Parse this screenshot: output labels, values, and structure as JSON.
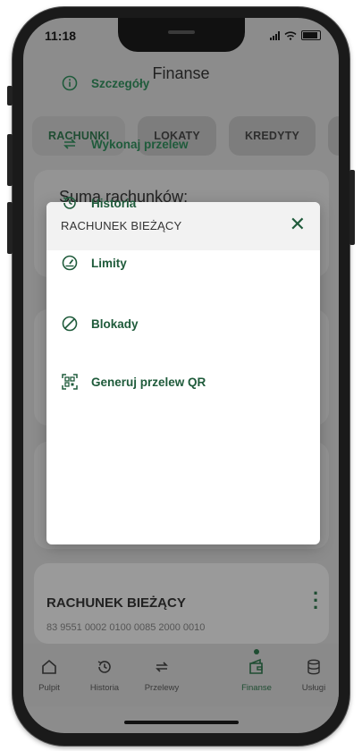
{
  "status_bar": {
    "time": "11:18"
  },
  "header": {
    "title": "Finanse"
  },
  "tabs": [
    {
      "label": "RACHUNKI"
    },
    {
      "label": "LOKATY"
    },
    {
      "label": "KREDYTY"
    },
    {
      "label": "KA"
    }
  ],
  "summary": {
    "label": "Suma rachunków:"
  },
  "modal": {
    "title": "RACHUNEK BIEŻĄCY",
    "items": [
      {
        "label": "Szczegóły",
        "icon": "info-icon"
      },
      {
        "label": "Wykonaj przelew",
        "icon": "transfer-icon"
      },
      {
        "label": "Historia",
        "icon": "history-icon"
      },
      {
        "label": "Limity",
        "icon": "gauge-icon"
      },
      {
        "label": "Blokady",
        "icon": "block-icon"
      },
      {
        "label": "Generuj przelew QR",
        "icon": "qr-icon"
      }
    ]
  },
  "account": {
    "name": "RACHUNEK BIEŻĄCY",
    "number": "83 9551 0002 0100 0085 2000 0010"
  },
  "nav": {
    "items": [
      {
        "label": "Pulpit",
        "icon": "home-icon"
      },
      {
        "label": "Historia",
        "icon": "history-icon"
      },
      {
        "label": "Przelewy",
        "icon": "transfer-icon"
      },
      {
        "label": "Finanse",
        "icon": "wallet-icon"
      },
      {
        "label": "Usługi",
        "icon": "database-icon"
      }
    ],
    "active": "Finanse"
  },
  "colors": {
    "accent": "#1f5b3b",
    "overlay": "#8c8c8c"
  }
}
